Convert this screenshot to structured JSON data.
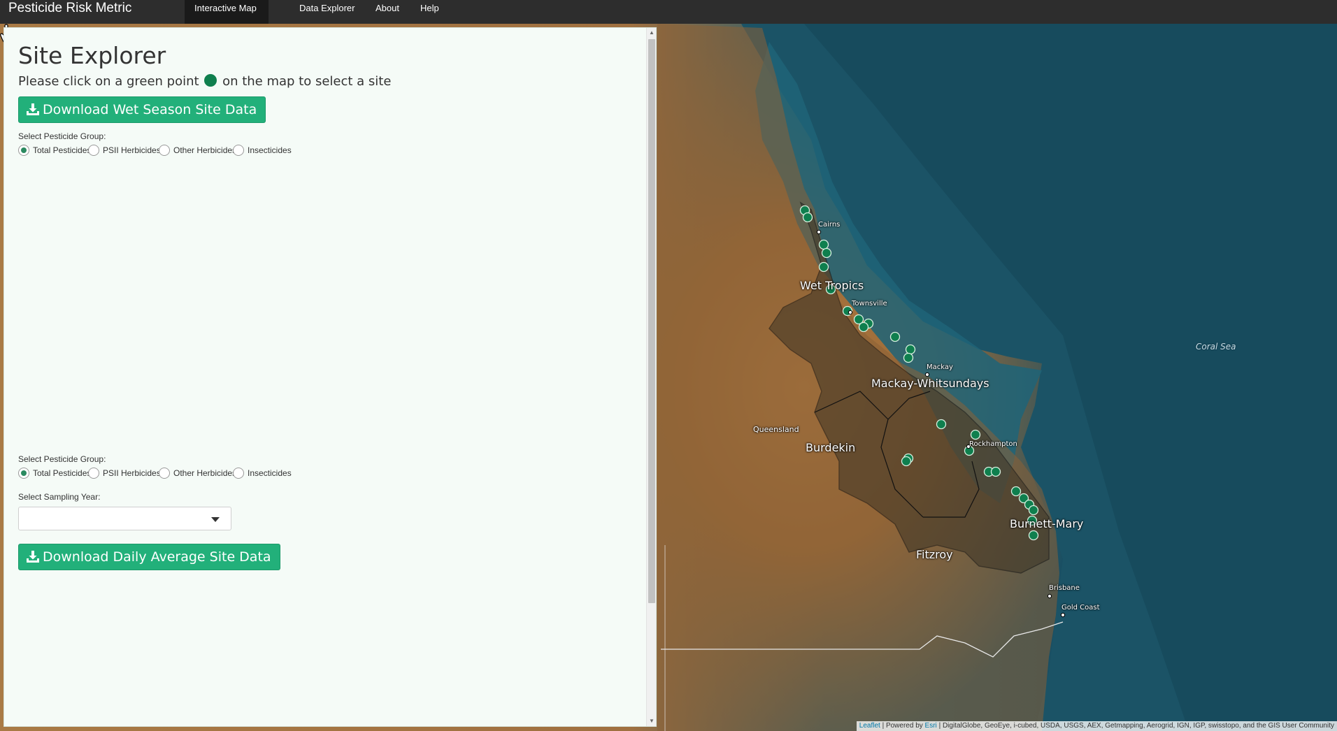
{
  "navbar": {
    "brand": "Pesticide Risk Metric",
    "tabs": [
      {
        "label": "Interactive Map",
        "active": true
      },
      {
        "label": "Data Explorer",
        "active": false
      },
      {
        "label": "About",
        "active": false
      },
      {
        "label": "Help",
        "active": false
      }
    ]
  },
  "panel": {
    "title": "Site Explorer",
    "instruction_before": "Please click on a green point",
    "instruction_after": "on the map to select a site",
    "download_wet_label": "Download Wet Season Site Data",
    "group_label_1": "Select Pesticide Group:",
    "group_label_2": "Select Pesticide Group:",
    "pesticide_options": [
      "Total Pesticides",
      "PSII Herbicides",
      "Other Herbicides",
      "Insecticides"
    ],
    "selected_option": "Total Pesticides",
    "year_label": "Select Sampling Year:",
    "year_value": "",
    "download_daily_label": "Download Daily Average Site Data"
  },
  "map": {
    "regions": [
      "Wet Tropics",
      "Mackay-Whitsundays",
      "Burdekin",
      "Fitzroy",
      "Burnett-Mary"
    ],
    "places": [
      "Cairns",
      "Townsville",
      "Mackay",
      "Rockhampton",
      "Brisbane",
      "Gold Coast",
      "Queensland"
    ],
    "sea": "Coral Sea",
    "site_color": "#0f7f4e",
    "attribution": {
      "leaflet": "Leaflet",
      "powered_by": "| Powered by",
      "esri": "Esri",
      "sources": "| DigitalGlobe, GeoEye, i-cubed, USDA, USGS, AEX, Getmapping, Aerogrid, IGN, IGP, swisstopo, and the GIS User Community"
    }
  },
  "colors": {
    "navbar": "#2d2d2d",
    "button": "#22b07a",
    "panel_bg": "#f5fbf7"
  }
}
